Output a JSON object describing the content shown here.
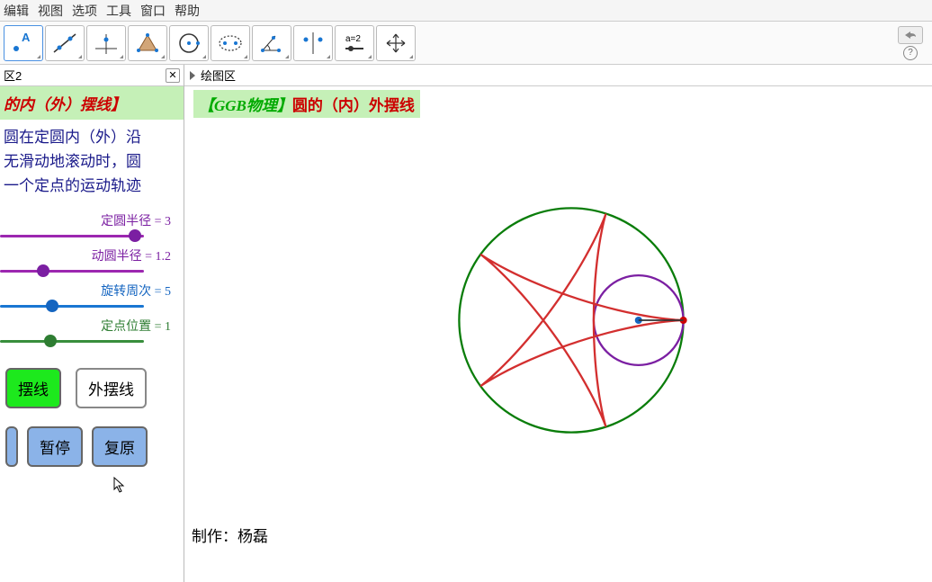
{
  "menu": {
    "edit": "编辑",
    "view": "视图",
    "options": "选项",
    "tools": "工具",
    "window": "窗口",
    "help": "帮助"
  },
  "leftPanel": {
    "header": "区2",
    "title": "的内（外）摆线】",
    "desc_l1_a": "圆在定圆内（外）沿",
    "desc_l2_a": "无滑动地滚动时，圆",
    "desc_l3_a": "一个定点的运动轨迹",
    "sliders": {
      "fixedRadius": {
        "label": "定圆半径 = 3",
        "pos": 94
      },
      "movingRadius": {
        "label": "动圆半径 = 1.2",
        "pos": 30
      },
      "rotations": {
        "label": "旋转周次 = 5",
        "pos": 36
      },
      "pointPos": {
        "label": "定点位置 = 1",
        "pos": 35
      }
    },
    "btn_hypo": "摆线",
    "btn_epi": "外摆线",
    "btn_pause": "暂停",
    "btn_reset": "复原"
  },
  "rightPanel": {
    "header": "绘图区",
    "title_prefix": "【GGB物理】",
    "title_main": "圆的（内）外摆线",
    "author": "制作：杨磊"
  },
  "chart_data": {
    "type": "hypocycloid",
    "fixed_circle_radius": 3,
    "moving_circle_radius": 1.2,
    "rotations": 5,
    "point_position": 1,
    "title": "圆的（内）外摆线"
  }
}
